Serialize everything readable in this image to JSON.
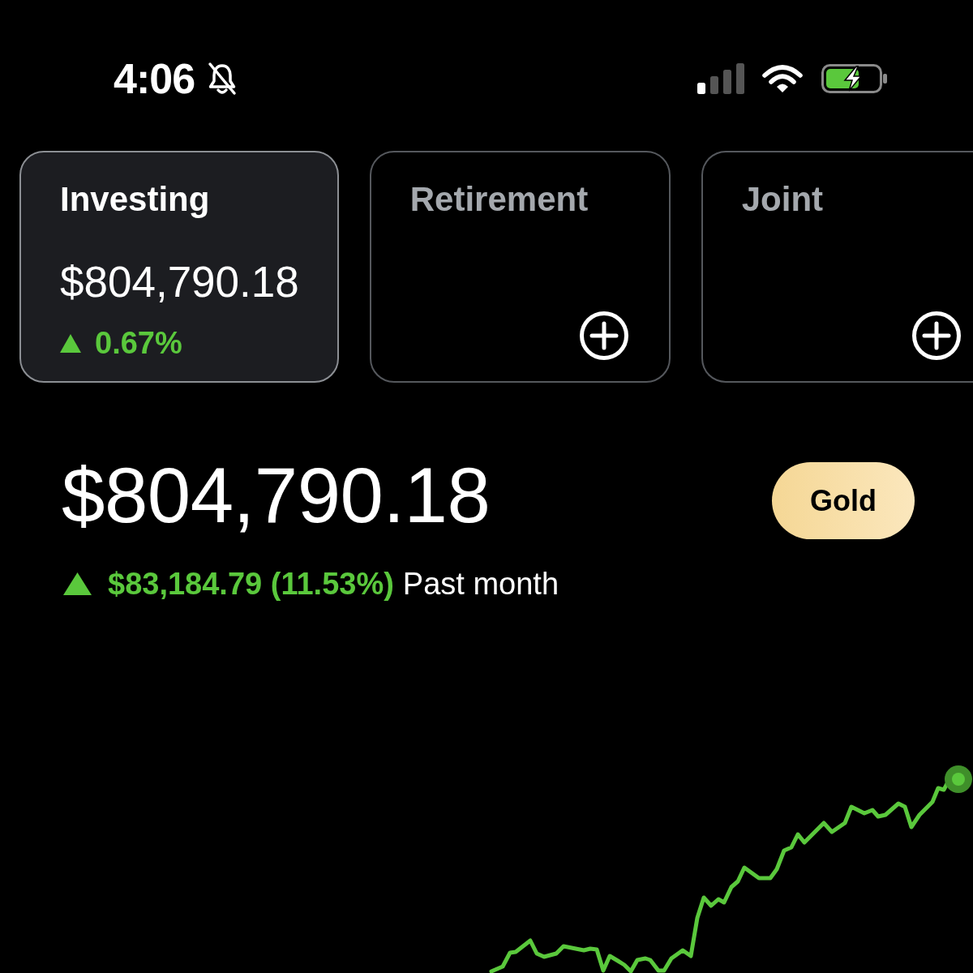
{
  "status_bar": {
    "time": "4:06",
    "silent": true
  },
  "accounts": [
    {
      "kind": "balance",
      "name": "Investing",
      "selected": true,
      "value": "$804,790.18",
      "rising": true,
      "change": "0.67%"
    },
    {
      "kind": "empty",
      "name": "Retirement",
      "selected": false
    },
    {
      "kind": "empty",
      "name": "Joint",
      "selected": false
    }
  ],
  "balance": {
    "value": "$804,790.18",
    "rising": true,
    "change": "$83,184.79 (11.53%)",
    "period": "Past month"
  },
  "membership": {
    "label": "Gold"
  }
}
